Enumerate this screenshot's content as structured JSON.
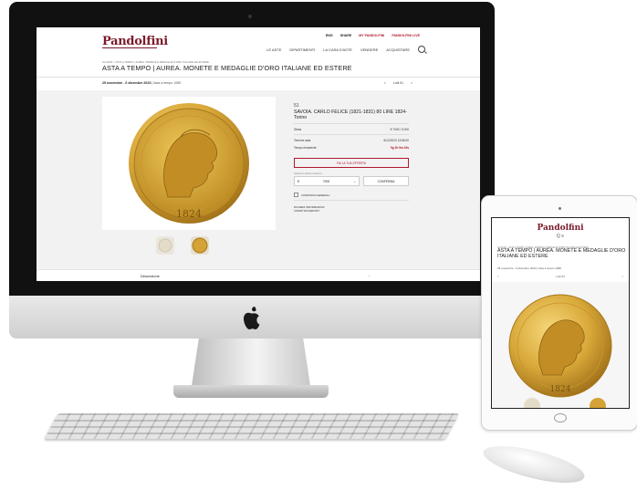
{
  "site": {
    "logo": "Pandolfini",
    "top_links": [
      "ENG",
      "SHARE",
      "MY PANDOLFINI",
      "PANDOLFINI LIVE"
    ],
    "nav": [
      "LE ASTE",
      "DIPARTIMENTI",
      "LA CASA D'ASTE",
      "VENDERE",
      "ACQUISTARE"
    ]
  },
  "sale": {
    "breadcrumb": "LE ASTE  >  ASTA A TEMPO | AUREA. MONETE E MEDAGLIE D'ORO ITALIANE ED ESTERE",
    "title": "ASTA A TEMPO | AUREA. MONETE E MEDAGLIE D'ORO ITALIANE ED ESTERE",
    "dates": "25 novembre - 6 dicembre 2023",
    "type": "Asta a tempo 1080",
    "lot_nav": [
      "<",
      "Lotti 51",
      ">"
    ]
  },
  "lot": {
    "number": "51",
    "title": "SAVOIA. CARLO FELICE (1821-1831) 80 LIRE 1824-Torino",
    "rows": [
      {
        "label": "Stima",
        "value": "€ 7000 / 9.000",
        "red": false
      },
      {
        "label": "Termine asta",
        "value": "6/12/2023 13:56:00",
        "red": false
      },
      {
        "label": "Tempo rimanente",
        "value": "5g 2h 9m 43s",
        "red": true
      }
    ],
    "bid_button": "FAI LA TUA OFFERTA",
    "bid_label": "Seleziona offerta massima",
    "amount_currency": "€",
    "amount_value": "7000",
    "confirm": "CONFERMA",
    "terms": "CONDIZIONI GENERALI",
    "extra_lines": [
      "RICHIEDI INFORMAZIONI",
      "CONDITION REPORT"
    ],
    "description": "Descrizione"
  },
  "ipad": {
    "logo": "Pandolfini",
    "icons": "Q  ≡",
    "breadcrumb": "LE ASTE  >  ASTA A TEMPO | AUREA. MONETE E MEDAGLIE D'ORO ITALIANE ED ESTERE",
    "title": "ASTA A TEMPO | AUREA. MONETE E MEDAGLIE D'ORO ITALIANE ED ESTERE",
    "dates": "25 novembre - 6 dicembre 2023  |  Asta a tempo 1080",
    "lot_nav": [
      "<",
      "Lotti 51",
      ">"
    ]
  },
  "colors": {
    "brand": "#7a1a2a",
    "accent_red": "#b0172f",
    "gold": "#d9a93a"
  },
  "icons": [
    "search-icon",
    "apple-logo-icon",
    "chevron-down-icon",
    "menu-icon"
  ]
}
